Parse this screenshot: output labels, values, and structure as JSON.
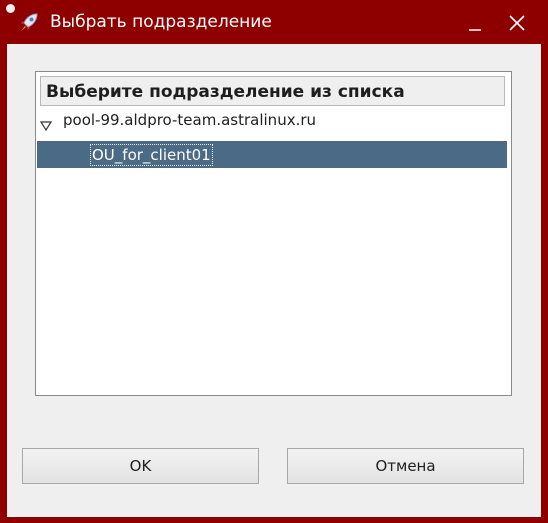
{
  "window": {
    "title": "Выбрать подразделение",
    "app_icon": "rocket-icon",
    "controls": [
      "minimize-icon",
      "close-icon"
    ]
  },
  "tree": {
    "header": "Выберите подразделение из списка",
    "root": {
      "label": "pool-99.aldpro-team.astralinux.ru",
      "expanded": true
    },
    "children": [
      {
        "label": "OU_for_client01",
        "selected": true
      }
    ]
  },
  "buttons": {
    "ok": "OK",
    "cancel": "Отмена"
  },
  "colors": {
    "title_bar": "#8e0000",
    "selection": "#4a6a85",
    "dialog_bg": "#efefef"
  }
}
